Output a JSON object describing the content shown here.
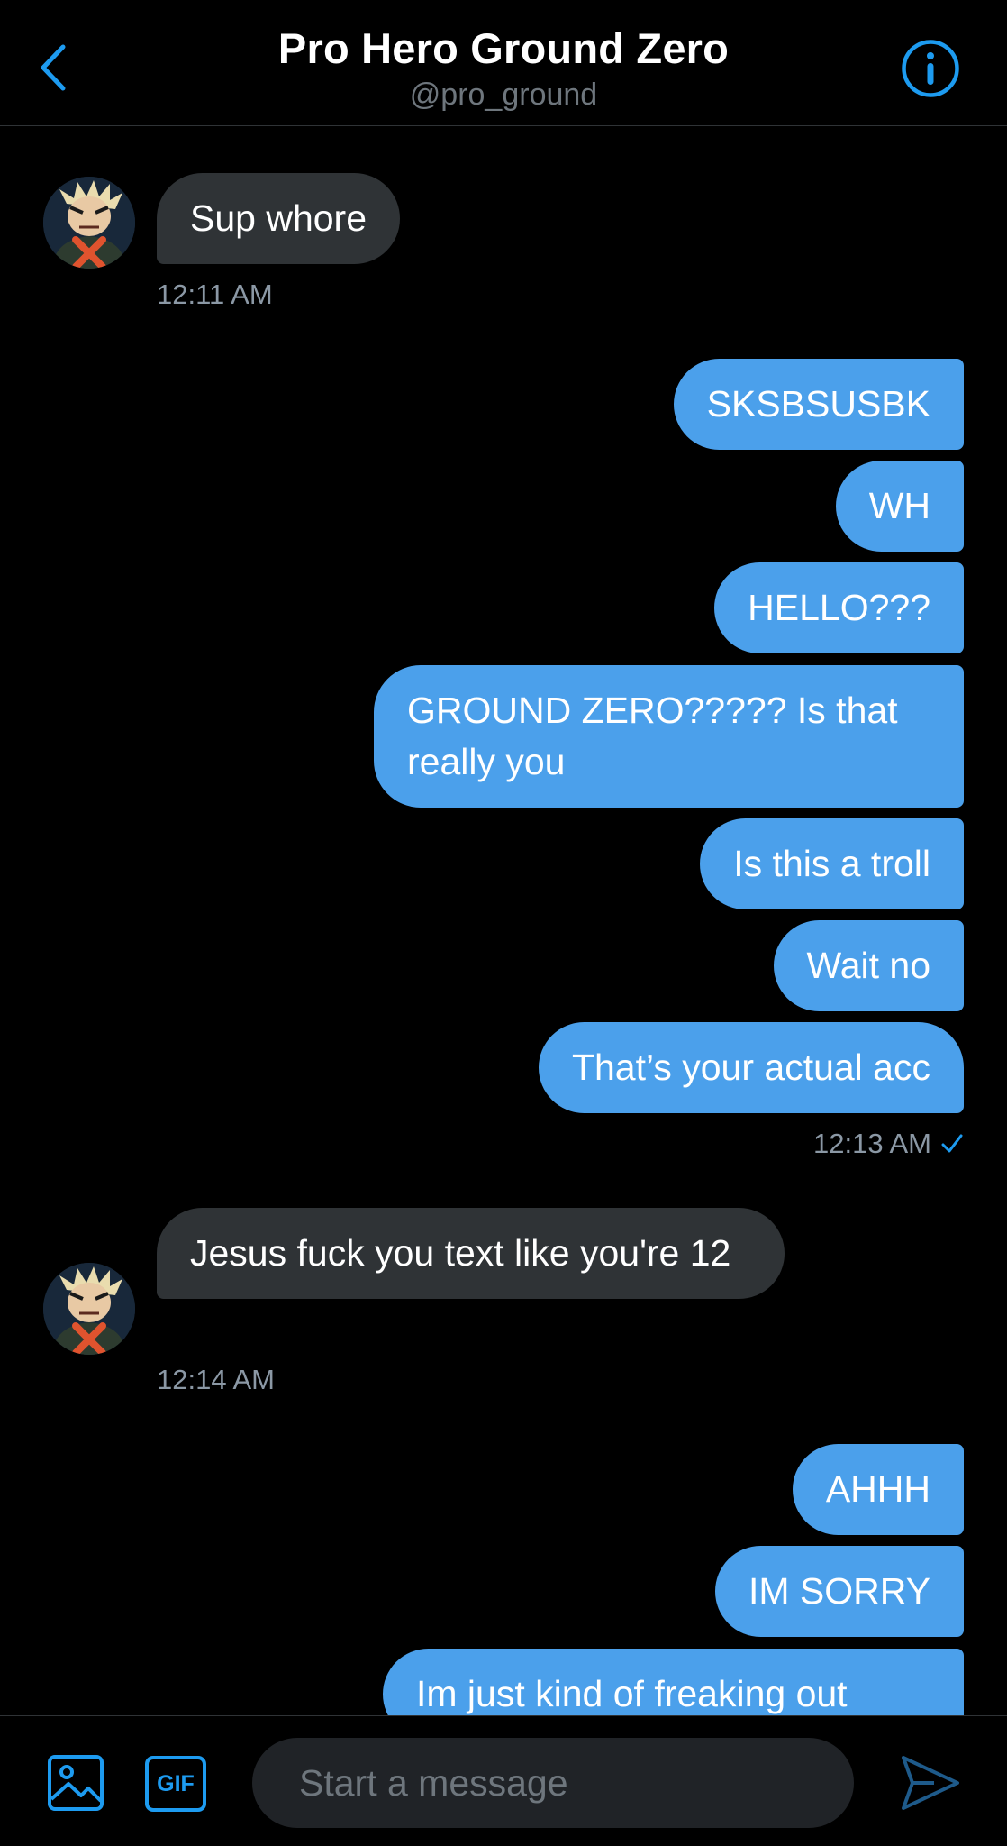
{
  "header": {
    "title": "Pro Hero Ground Zero",
    "handle": "@pro_ground",
    "back_icon": "chevron-left-icon",
    "info_icon": "info-circle-icon"
  },
  "colors": {
    "accent": "#1d9bf0",
    "sent_bubble": "#4ba0eb",
    "received_bubble": "#2f3336",
    "background": "#000000"
  },
  "messages": {
    "g1_m1": "Sup whore",
    "g1_time": "12:11 AM",
    "g2_m1": "SKSBSUSBK",
    "g2_m2": "WH",
    "g2_m3": "HELLO???",
    "g2_m4": "GROUND ZERO????? Is that really you",
    "g2_m5": "Is this a troll",
    "g2_m6": "Wait no",
    "g2_m7": "That’s your actual acc",
    "g2_time": "12:13 AM",
    "g3_m1": "Jesus fuck you text like you're 12",
    "g3_time": "12:14 AM",
    "g4_m1": "AHHH",
    "g4_m2": "IM SORRY",
    "g4_m3": "Im just kind of freaking out"
  },
  "composer": {
    "placeholder": "Start a message",
    "gif_label": "GIF",
    "media_icon": "image-icon",
    "send_icon": "send-icon"
  }
}
